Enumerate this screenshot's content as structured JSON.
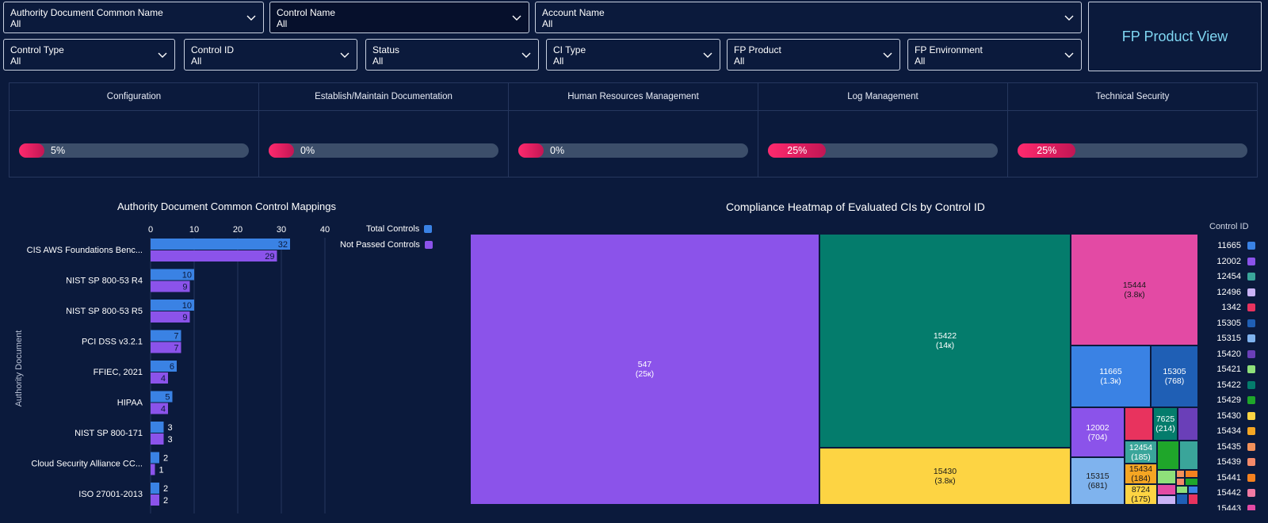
{
  "filters_row1": [
    {
      "label": "Authority Document Common Name",
      "value": "All",
      "dark": false
    },
    {
      "label": "Control Name",
      "value": "All",
      "dark": true
    },
    {
      "label": "Account Name",
      "value": "All",
      "dark": false
    }
  ],
  "filters_row2": [
    {
      "label": "Control Type",
      "value": "All"
    },
    {
      "label": "Control ID",
      "value": "All"
    },
    {
      "label": "Status",
      "value": "All"
    },
    {
      "label": "CI Type",
      "value": "All"
    },
    {
      "label": "FP Product",
      "value": "All"
    },
    {
      "label": "FP Environment",
      "value": "All"
    }
  ],
  "fp_view_label": "FP Product View",
  "categories": [
    {
      "name": "Configuration",
      "percent_label": "5%",
      "percent": 5
    },
    {
      "name": "Establish/Maintain Documentation",
      "percent_label": "0%",
      "percent": 0
    },
    {
      "name": "Human Resources Management",
      "percent_label": "0%",
      "percent": 0
    },
    {
      "name": "Log Management",
      "percent_label": "25%",
      "percent": 25
    },
    {
      "name": "Technical Security",
      "percent_label": "25%",
      "percent": 25
    }
  ],
  "colors": {
    "total": "#3a82e4",
    "not_passed": "#8b53ea",
    "progress": "#ff2a6e",
    "track": "#3c4e6a",
    "accent": "#7fd6f2"
  },
  "chart_data": [
    {
      "type": "bar",
      "orientation": "horizontal",
      "title": "Authority Document Common Control Mappings",
      "ylabel": "Authority Document",
      "xlim": [
        0,
        40
      ],
      "xticks": [
        0,
        10,
        20,
        30,
        40
      ],
      "categories": [
        "CIS AWS Foundations Benc...",
        "NIST SP 800-53 R4",
        "NIST SP 800-53 R5",
        "PCI DSS v3.2.1",
        "FFIEC, 2021",
        "HIPAA",
        "NIST SP 800-171",
        "Cloud Security Alliance CC...",
        "ISO 27001-2013"
      ],
      "series": [
        {
          "name": "Total Controls",
          "color": "#3a82e4",
          "values": [
            32,
            10,
            10,
            7,
            6,
            5,
            3,
            2,
            2
          ]
        },
        {
          "name": "Not Passed Controls",
          "color": "#8b53ea",
          "values": [
            29,
            9,
            9,
            7,
            4,
            4,
            3,
            1,
            2
          ]
        }
      ],
      "legend": "right"
    },
    {
      "type": "treemap",
      "title": "Compliance Heatmap of Evaluated CIs by Control ID",
      "legend_title": "Control ID",
      "nodes": [
        {
          "id": "547",
          "value_label": "(25к)",
          "color": "#8b53ea"
        },
        {
          "id": "15422",
          "value_label": "(14к)",
          "color": "#047c6c"
        },
        {
          "id": "15430",
          "value_label": "(3.8к)",
          "color": "#fdd443"
        },
        {
          "id": "15444",
          "value_label": "(3.8к)",
          "color": "#e34aa4"
        },
        {
          "id": "11665",
          "value_label": "(1.3к)",
          "color": "#3a82e4"
        },
        {
          "id": "15305",
          "value_label": "(768)",
          "color": "#1f5fb5"
        },
        {
          "id": "12002",
          "value_label": "(704)",
          "color": "#8b53ea"
        },
        {
          "id": "7625",
          "value_label": "(214)",
          "color": "#047c6c"
        },
        {
          "id": "12454",
          "value_label": "(185)",
          "color": "#3aa59a"
        },
        {
          "id": "15434",
          "value_label": "(184)",
          "color": "#f5a623"
        },
        {
          "id": "15315",
          "value_label": "(681)",
          "color": "#7fb3ee"
        },
        {
          "id": "8724",
          "value_label": "(175)",
          "color": "#fdd443"
        }
      ],
      "legend": [
        {
          "id": "11665",
          "color": "#3a82e4"
        },
        {
          "id": "12002",
          "color": "#8b53ea"
        },
        {
          "id": "12454",
          "color": "#3aa59a"
        },
        {
          "id": "12496",
          "color": "#c9b3f7"
        },
        {
          "id": "1342",
          "color": "#e8335e"
        },
        {
          "id": "15305",
          "color": "#1f5fb5"
        },
        {
          "id": "15315",
          "color": "#7fb3ee"
        },
        {
          "id": "15420",
          "color": "#6a3fb8"
        },
        {
          "id": "15421",
          "color": "#8fe07a"
        },
        {
          "id": "15422",
          "color": "#047c6c"
        },
        {
          "id": "15429",
          "color": "#1fa62a"
        },
        {
          "id": "15430",
          "color": "#fdd443"
        },
        {
          "id": "15434",
          "color": "#f5a623"
        },
        {
          "id": "15435",
          "color": "#f2915a"
        },
        {
          "id": "15439",
          "color": "#f48a6a"
        },
        {
          "id": "15441",
          "color": "#f5821f"
        },
        {
          "id": "15442",
          "color": "#f07aa3"
        },
        {
          "id": "15443",
          "color": "#e34aa4"
        }
      ]
    }
  ]
}
